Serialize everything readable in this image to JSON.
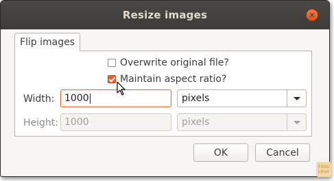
{
  "window": {
    "title": "Resize images",
    "close_symbol": "✕"
  },
  "tabs": [
    {
      "label": "Flip images"
    }
  ],
  "options": {
    "overwrite": {
      "label": "Overwrite original file?",
      "checked": false
    },
    "aspect": {
      "label": "Maintain aspect ratio?",
      "checked": true
    }
  },
  "width": {
    "label": "Width:",
    "value": "1000",
    "unit": "pixels"
  },
  "height": {
    "label": "Height:",
    "value": "1000",
    "unit": "pixels"
  },
  "buttons": {
    "ok": "OK",
    "cancel": "Cancel"
  },
  "watermark": {
    "line1": "FOSS",
    "line2": "Linux"
  },
  "colors": {
    "accent": "#e8612c",
    "titlebar": "#3c3b37",
    "close": "#e25517"
  }
}
